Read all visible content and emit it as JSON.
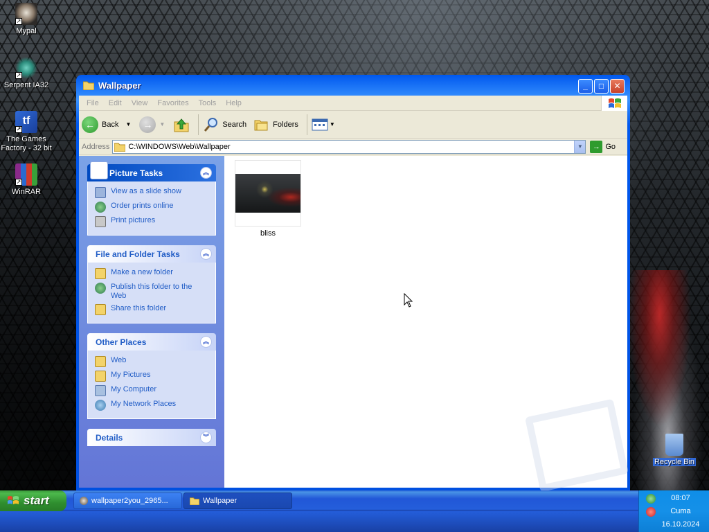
{
  "desktop": {
    "icons": [
      {
        "label": "Mypal",
        "icon": "mypal-icon"
      },
      {
        "label": "Serpent IA32",
        "icon": "serpent-icon"
      },
      {
        "label": "The Games Factory - 32 bit",
        "icon": "games-factory-icon"
      },
      {
        "label": "WinRAR",
        "icon": "winrar-icon"
      },
      {
        "label": "Recycle Bin",
        "icon": "recycle-bin-icon"
      }
    ]
  },
  "window": {
    "title": "Wallpaper",
    "menu": [
      "File",
      "Edit",
      "View",
      "Favorites",
      "Tools",
      "Help"
    ],
    "toolbar": {
      "back": "Back",
      "search": "Search",
      "folders": "Folders"
    },
    "address": {
      "label": "Address",
      "path": "C:\\WINDOWS\\Web\\Wallpaper",
      "go": "Go"
    },
    "panels": {
      "picture_tasks": {
        "title": "Picture Tasks",
        "items": [
          "View as a slide show",
          "Order prints online",
          "Print pictures"
        ]
      },
      "file_folder_tasks": {
        "title": "File and Folder Tasks",
        "items": [
          "Make a new folder",
          "Publish this folder to the Web",
          "Share this folder"
        ]
      },
      "other_places": {
        "title": "Other Places",
        "items": [
          "Web",
          "My Pictures",
          "My Computer",
          "My Network Places"
        ]
      },
      "details": {
        "title": "Details"
      }
    },
    "files": [
      {
        "name": "bliss"
      }
    ]
  },
  "taskbar": {
    "start_label": "start",
    "buttons": [
      {
        "label": "wallpaper2you_2965..."
      },
      {
        "label": "Wallpaper"
      }
    ],
    "clock": {
      "time": "08:07",
      "day": "Cuma",
      "date": "16.10.2024"
    }
  },
  "colors": {
    "title_blue": "#0058ee",
    "task_pane_blue": "#7ba2e7",
    "link_blue": "#215dc6",
    "start_green": "#3c9b3c",
    "taskbar_blue": "#245edb",
    "tray_blue": "#0f8ee8"
  }
}
